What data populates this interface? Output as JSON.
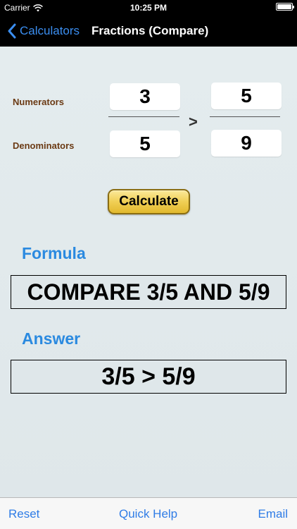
{
  "status_bar": {
    "carrier": "Carrier",
    "time": "10:25 PM",
    "icons": [
      "wifi-icon",
      "battery-icon"
    ]
  },
  "nav": {
    "back_label": "Calculators",
    "title": "Fractions (Compare)"
  },
  "fractions": {
    "numerators_label": "Numerators",
    "denominators_label": "Denominators",
    "first": {
      "numerator": "3",
      "denominator": "5"
    },
    "second": {
      "numerator": "5",
      "denominator": "9"
    },
    "comparison_symbol": ">"
  },
  "calculate_label": "Calculate",
  "formula": {
    "heading": "Formula",
    "text": "COMPARE 3/5 AND 5/9"
  },
  "answer": {
    "heading": "Answer",
    "text": "3/5 > 5/9"
  },
  "toolbar": {
    "reset_label": "Reset",
    "quick_help_label": "Quick Help",
    "email_label": "Email"
  },
  "colors": {
    "accent": "#2f7ce6",
    "heading_blue": "#2b8ae0",
    "label_brown": "#6b3a14",
    "calculate_gold": "#f0cf55"
  }
}
